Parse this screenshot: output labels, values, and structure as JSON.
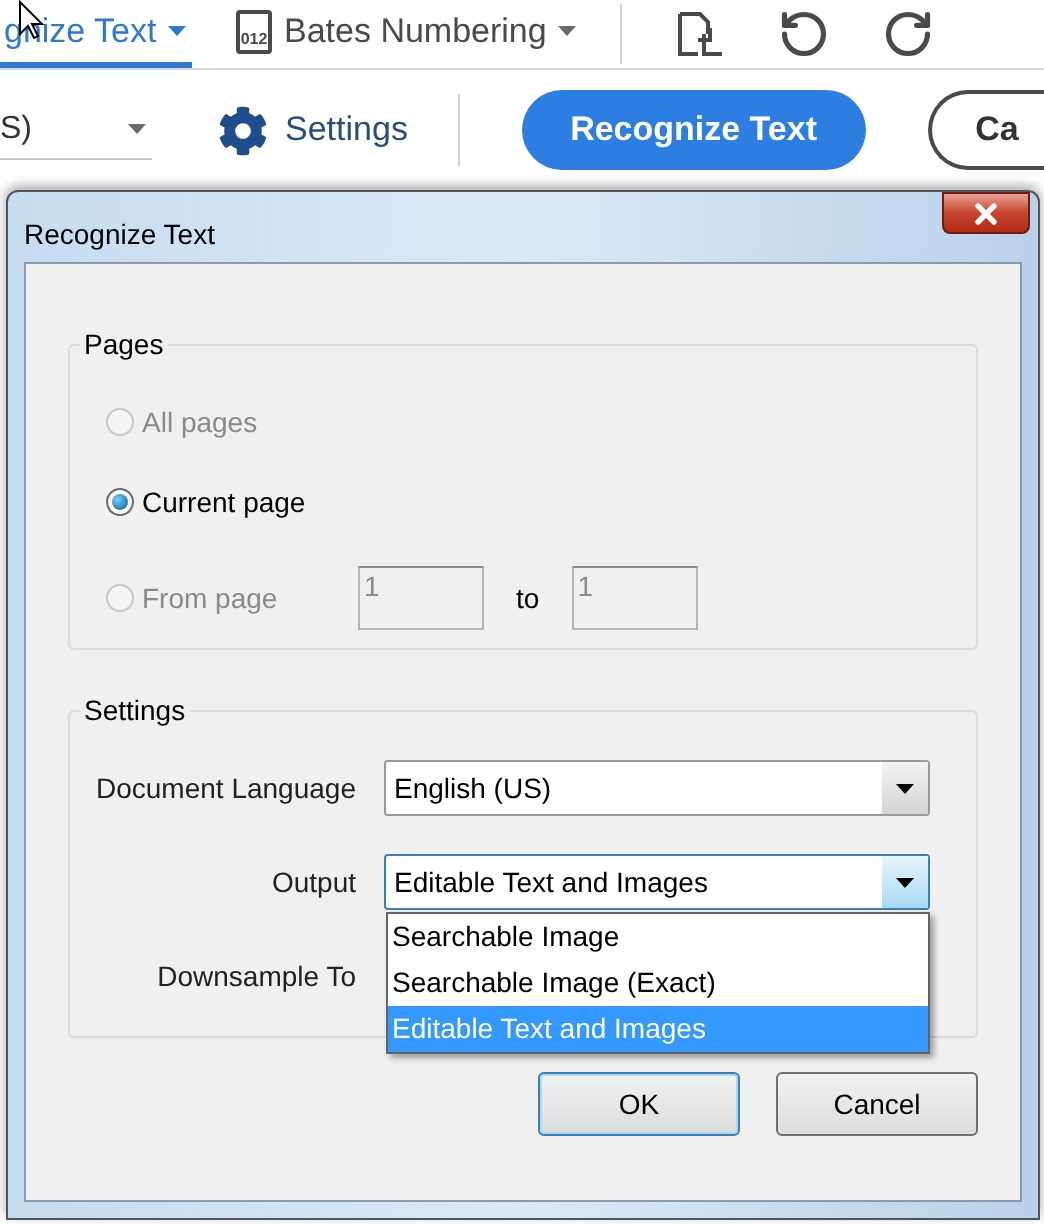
{
  "toolbar": {
    "tabs": [
      {
        "label": "gnize Text",
        "selected": true
      },
      {
        "label": "Bates Numbering",
        "icon_text": "012",
        "selected": false
      }
    ],
    "language_dropdown": {
      "value": "S)"
    },
    "settings_button": "Settings",
    "recognize_button": "Recognize Text",
    "cancel_button": "Ca"
  },
  "dialog": {
    "title": "Recognize Text",
    "pages": {
      "title": "Pages",
      "options": [
        {
          "label": "All pages",
          "selected": false,
          "disabled": true
        },
        {
          "label": "Current page",
          "selected": true,
          "disabled": false
        },
        {
          "label": "From page",
          "selected": false,
          "disabled": true
        }
      ],
      "from_value": "1",
      "to_label": "to",
      "to_value": "1"
    },
    "settings": {
      "title": "Settings",
      "fields": [
        {
          "label": "Document Language",
          "value": "English (US)",
          "open": false
        },
        {
          "label": "Output",
          "value": "Editable Text and Images",
          "open": true,
          "options": [
            {
              "label": "Searchable Image",
              "selected": false
            },
            {
              "label": "Searchable Image (Exact)",
              "selected": false
            },
            {
              "label": "Editable Text and Images",
              "selected": true
            }
          ]
        },
        {
          "label": "Downsample To"
        }
      ]
    },
    "buttons": [
      {
        "label": "OK",
        "default": true
      },
      {
        "label": "Cancel",
        "default": false
      }
    ]
  }
}
